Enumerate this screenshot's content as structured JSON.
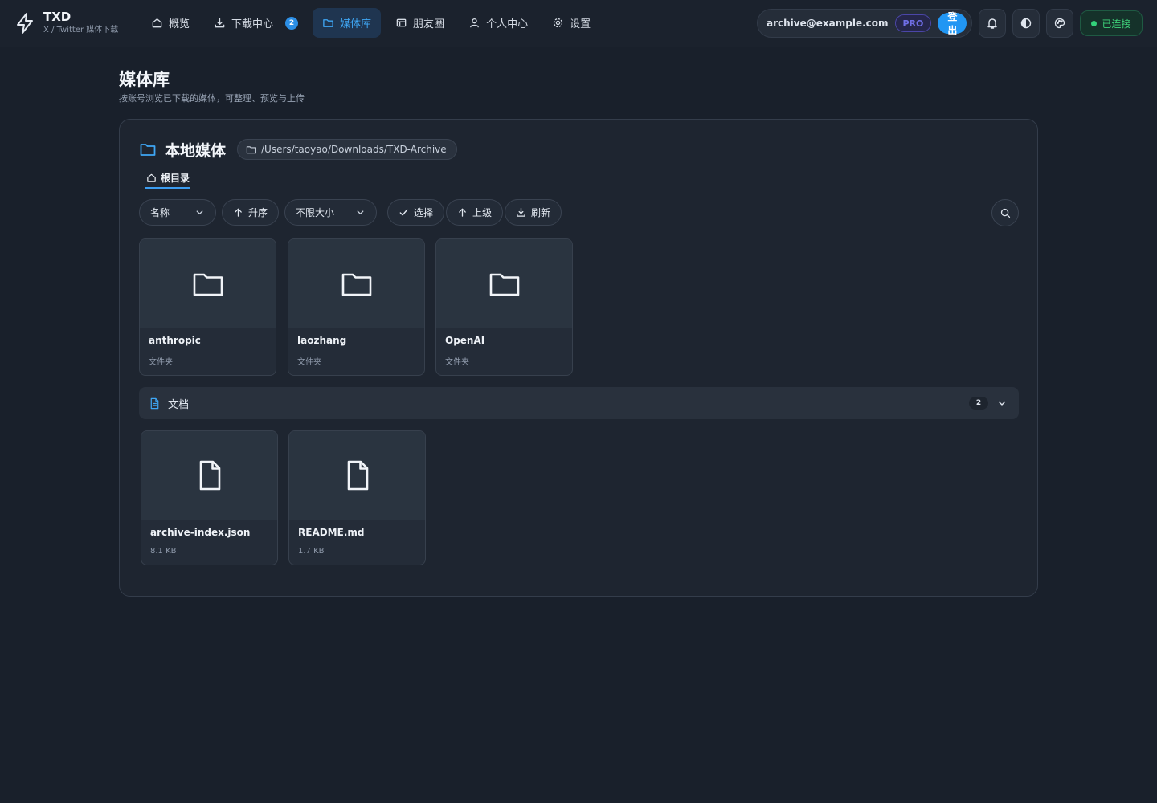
{
  "header": {
    "brand": "TXD",
    "brand_sub": "X / Twitter 媒体下载",
    "nav": [
      {
        "label": "概览",
        "icon": "home-icon"
      },
      {
        "label": "下载中心",
        "icon": "download-icon",
        "badge": "2"
      },
      {
        "label": "媒体库",
        "icon": "folder-icon",
        "active": true
      },
      {
        "label": "朋友圈",
        "icon": "feed-icon"
      },
      {
        "label": "个人中心",
        "icon": "user-icon"
      },
      {
        "label": "设置",
        "icon": "gear-icon"
      }
    ],
    "account_email": "archive@example.com",
    "plan": "PRO",
    "logout": "登出",
    "status": "已连接"
  },
  "page": {
    "title": "媒体库",
    "subtitle": "按账号浏览已下载的媒体，可整理、预览与上传"
  },
  "panel": {
    "title": "本地媒体",
    "path": "/Users/taoyao/Downloads/TXD-Archive",
    "breadcrumb": "根目录",
    "toolbar": {
      "sort_field": "名称",
      "sort_order": "升序",
      "size_filter": "不限大小",
      "select": "选择",
      "parent": "上级",
      "refresh": "刷新"
    },
    "folders": [
      {
        "name": "anthropic",
        "meta": "文件夹"
      },
      {
        "name": "laozhang",
        "meta": "文件夹"
      },
      {
        "name": "OpenAI",
        "meta": "文件夹"
      }
    ],
    "docs_section": {
      "label": "文档",
      "count": "2"
    },
    "files": [
      {
        "name": "archive-index.json",
        "meta": "8.1 KB"
      },
      {
        "name": "README.md",
        "meta": "1.7 KB"
      }
    ]
  },
  "colors": {
    "background": "#19202b",
    "accent": "#2196f3",
    "active_nav": "#3fa7f5",
    "connected": "#33d17a",
    "pro": "#6f6ee6"
  }
}
